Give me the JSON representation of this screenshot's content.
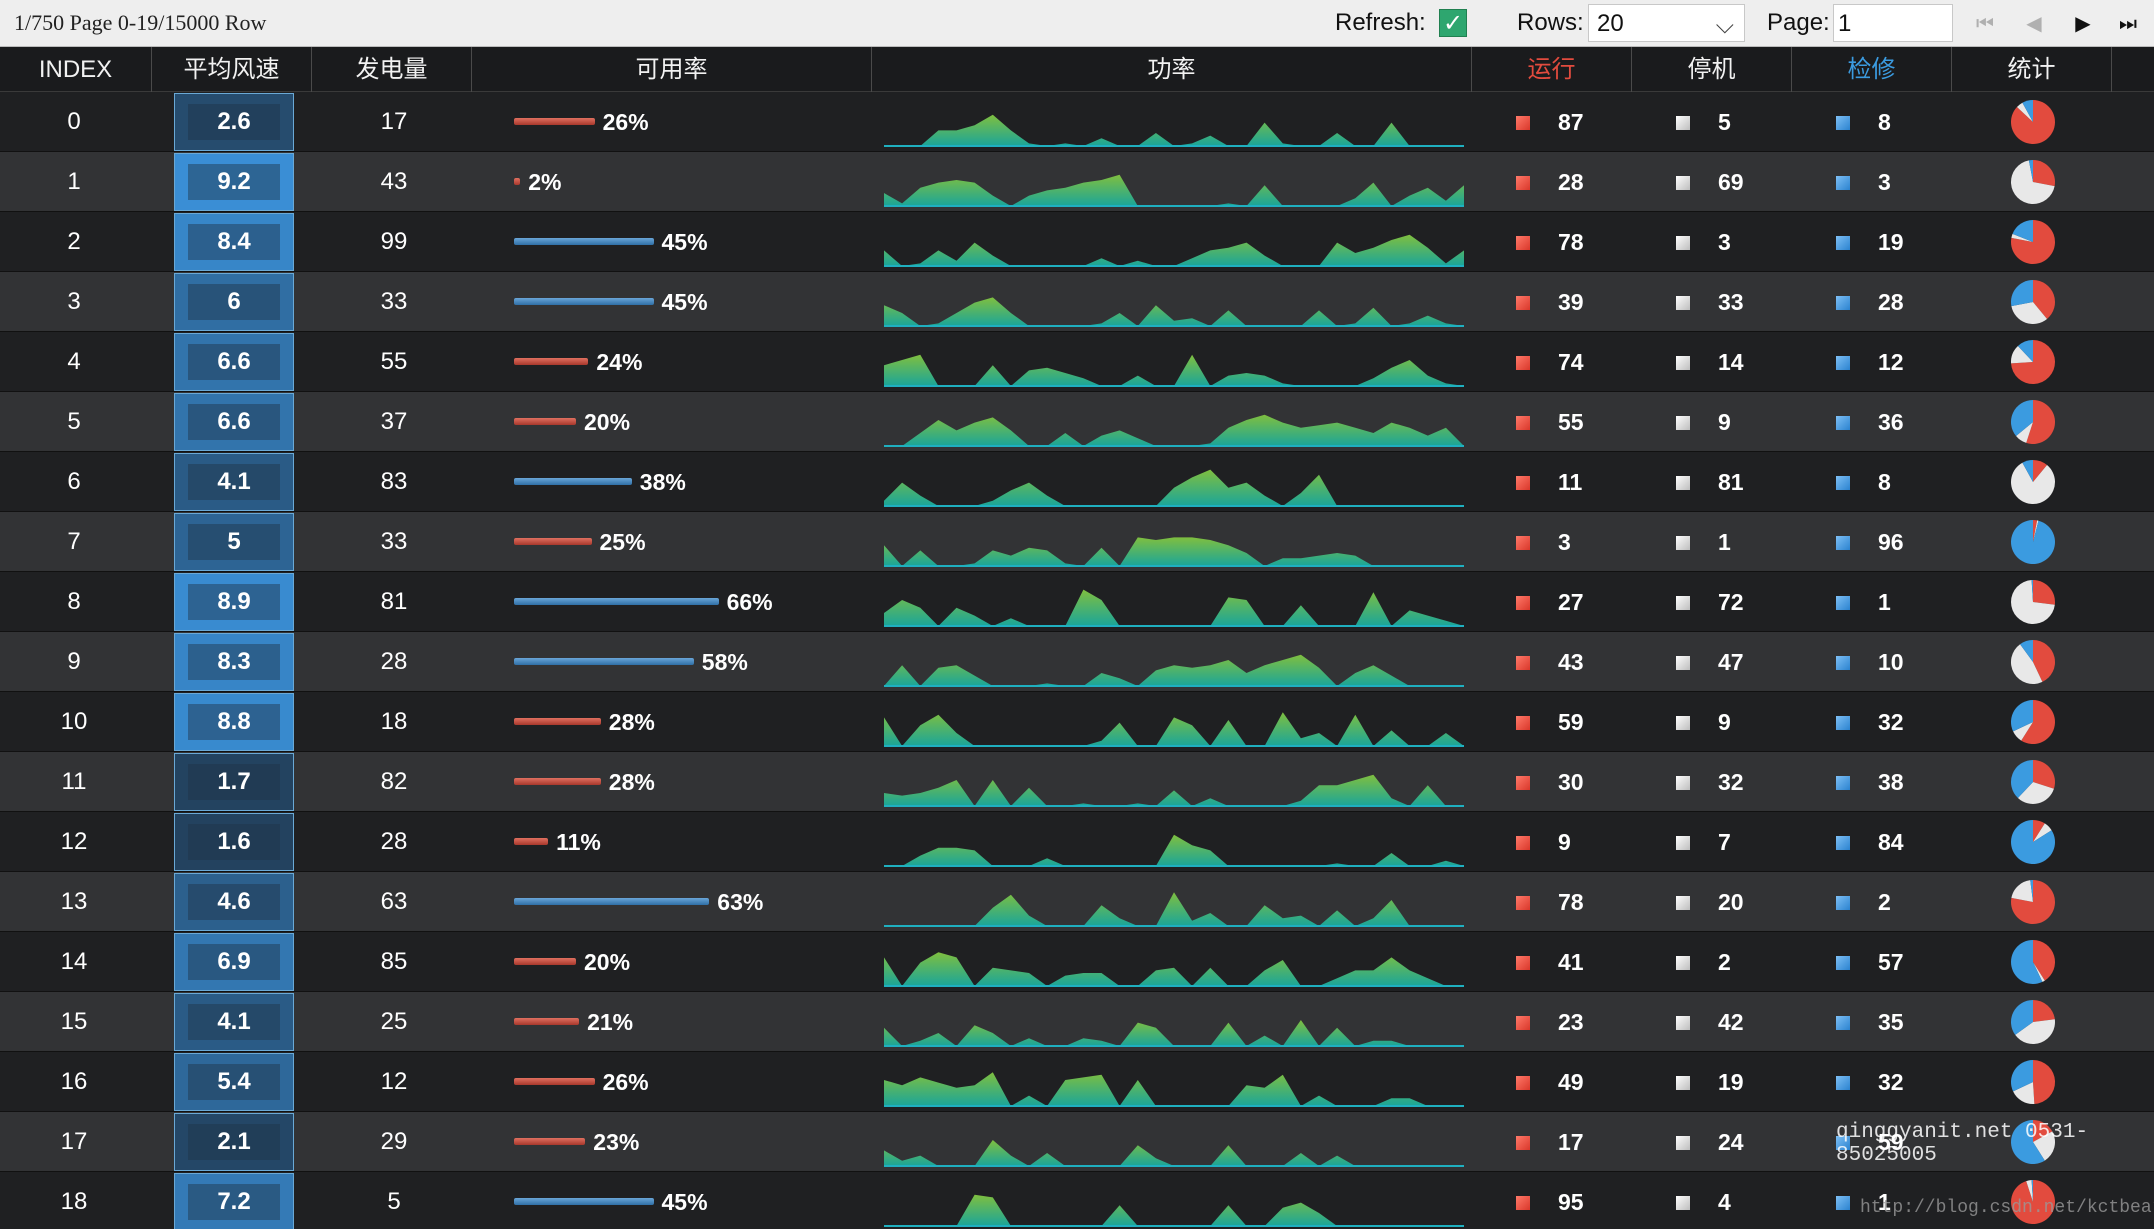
{
  "toolbar": {
    "info": "1/750 Page 0-19/15000 Row",
    "refresh_label": "Refresh:",
    "refresh_checked": true,
    "rows_label": "Rows:",
    "rows_value": "20",
    "page_label": "Page:",
    "page_value": "1"
  },
  "columns": {
    "index": "INDEX",
    "wind": "平均风速",
    "power_gen": "发电量",
    "availability": "可用率",
    "power": "功率",
    "running": "运行",
    "stopped": "停机",
    "maintenance": "检修",
    "stats": "统计"
  },
  "colors": {
    "running": "#e24b3e",
    "stopped": "#e8e8e8",
    "maintenance": "#3b9be0",
    "area_top": "#7fbf3f",
    "area_bottom": "#1aa59a"
  },
  "rows": [
    {
      "index": "0",
      "wind": "2.6",
      "gen": "17",
      "avail": 26,
      "avail_text": "26%",
      "run": "87",
      "stop": "5",
      "maint": "8",
      "spark": [
        0,
        0,
        0,
        6,
        6,
        8,
        12,
        6,
        1,
        0,
        1,
        0,
        3,
        0,
        0,
        5,
        0,
        1,
        4,
        0,
        0,
        9,
        1,
        0,
        0,
        5,
        0,
        0,
        9,
        0,
        0,
        0,
        0
      ]
    },
    {
      "index": "1",
      "wind": "9.2",
      "gen": "43",
      "avail": 2,
      "avail_text": "2%",
      "run": "28",
      "stop": "69",
      "maint": "3",
      "spark": [
        5,
        1,
        7,
        9,
        10,
        9,
        4,
        0,
        4,
        6,
        7,
        9,
        10,
        12,
        0,
        0,
        0,
        0,
        0,
        1,
        0,
        8,
        0,
        0,
        0,
        0,
        3,
        9,
        0,
        4,
        7,
        2,
        8
      ]
    },
    {
      "index": "2",
      "wind": "8.4",
      "gen": "99",
      "avail": 45,
      "avail_text": "45%",
      "run": "78",
      "stop": "3",
      "maint": "19",
      "spark": [
        6,
        0,
        1,
        6,
        2,
        9,
        4,
        0,
        0,
        0,
        0,
        0,
        3,
        0,
        2,
        0,
        0,
        3,
        6,
        7,
        9,
        4,
        0,
        0,
        0,
        9,
        5,
        7,
        10,
        12,
        7,
        1,
        6
      ]
    },
    {
      "index": "3",
      "wind": "6",
      "gen": "33",
      "avail": 45,
      "avail_text": "45%",
      "run": "39",
      "stop": "33",
      "maint": "28",
      "spark": [
        8,
        5,
        0,
        1,
        5,
        9,
        11,
        5,
        0,
        0,
        0,
        0,
        1,
        5,
        0,
        8,
        2,
        3,
        0,
        6,
        0,
        0,
        0,
        0,
        6,
        0,
        1,
        7,
        0,
        1,
        4,
        1,
        0
      ]
    },
    {
      "index": "4",
      "wind": "6.6",
      "gen": "55",
      "avail": 24,
      "avail_text": "24%",
      "run": "74",
      "stop": "14",
      "maint": "12",
      "spark": [
        8,
        10,
        12,
        0,
        0,
        0,
        8,
        0,
        6,
        7,
        5,
        3,
        0,
        0,
        4,
        0,
        0,
        12,
        0,
        4,
        5,
        4,
        1,
        0,
        0,
        0,
        0,
        3,
        7,
        10,
        4,
        1,
        0
      ]
    },
    {
      "index": "5",
      "wind": "6.6",
      "gen": "37",
      "avail": 20,
      "avail_text": "20%",
      "run": "55",
      "stop": "9",
      "maint": "36",
      "spark": [
        0,
        0,
        5,
        10,
        6,
        9,
        11,
        6,
        0,
        0,
        5,
        0,
        4,
        6,
        3,
        0,
        0,
        0,
        1,
        7,
        10,
        12,
        9,
        7,
        8,
        9,
        7,
        5,
        9,
        7,
        4,
        7,
        0
      ]
    },
    {
      "index": "6",
      "wind": "4.1",
      "gen": "83",
      "avail": 38,
      "avail_text": "38%",
      "run": "11",
      "stop": "81",
      "maint": "8",
      "spark": [
        2,
        9,
        4,
        0,
        0,
        0,
        2,
        6,
        9,
        4,
        0,
        0,
        0,
        0,
        0,
        0,
        7,
        11,
        14,
        7,
        9,
        4,
        0,
        5,
        12,
        0,
        0,
        0,
        0,
        0,
        0,
        0,
        0
      ]
    },
    {
      "index": "7",
      "wind": "5",
      "gen": "33",
      "avail": 25,
      "avail_text": "25%",
      "run": "3",
      "stop": "1",
      "maint": "96",
      "spark": [
        8,
        0,
        6,
        0,
        0,
        1,
        6,
        4,
        7,
        6,
        1,
        0,
        7,
        0,
        11,
        10,
        11,
        11,
        10,
        8,
        5,
        0,
        3,
        3,
        4,
        5,
        4,
        0,
        0,
        0,
        0,
        0,
        0
      ]
    },
    {
      "index": "8",
      "wind": "8.9",
      "gen": "81",
      "avail": 66,
      "avail_text": "66%",
      "run": "27",
      "stop": "72",
      "maint": "1",
      "spark": [
        5,
        10,
        7,
        0,
        7,
        4,
        0,
        3,
        0,
        0,
        0,
        14,
        10,
        0,
        0,
        0,
        0,
        0,
        0,
        11,
        10,
        0,
        0,
        8,
        0,
        0,
        0,
        13,
        0,
        6,
        4,
        2,
        0
      ]
    },
    {
      "index": "9",
      "wind": "8.3",
      "gen": "28",
      "avail": 58,
      "avail_text": "58%",
      "run": "43",
      "stop": "47",
      "maint": "10",
      "spark": [
        0,
        8,
        0,
        7,
        8,
        4,
        0,
        0,
        0,
        1,
        0,
        0,
        5,
        3,
        0,
        6,
        8,
        7,
        8,
        10,
        5,
        8,
        10,
        12,
        7,
        0,
        5,
        8,
        4,
        0,
        0,
        0,
        0
      ]
    },
    {
      "index": "10",
      "wind": "8.8",
      "gen": "18",
      "avail": 28,
      "avail_text": "28%",
      "run": "59",
      "stop": "9",
      "maint": "32",
      "spark": [
        11,
        0,
        8,
        12,
        5,
        0,
        0,
        0,
        0,
        0,
        0,
        0,
        2,
        9,
        0,
        0,
        11,
        8,
        0,
        10,
        0,
        0,
        13,
        3,
        5,
        0,
        12,
        0,
        6,
        0,
        0,
        5,
        0
      ]
    },
    {
      "index": "11",
      "wind": "1.7",
      "gen": "82",
      "avail": 28,
      "avail_text": "28%",
      "run": "30",
      "stop": "32",
      "maint": "38",
      "spark": [
        5,
        4,
        5,
        7,
        10,
        0,
        10,
        0,
        7,
        0,
        0,
        1,
        0,
        0,
        1,
        0,
        6,
        0,
        3,
        0,
        0,
        0,
        0,
        2,
        8,
        8,
        10,
        12,
        3,
        0,
        8,
        0,
        0
      ]
    },
    {
      "index": "12",
      "wind": "1.6",
      "gen": "28",
      "avail": 11,
      "avail_text": "11%",
      "run": "9",
      "stop": "7",
      "maint": "84",
      "spark": [
        0,
        0,
        4,
        7,
        7,
        6,
        0,
        0,
        0,
        3,
        0,
        0,
        0,
        0,
        0,
        0,
        12,
        8,
        6,
        0,
        0,
        0,
        0,
        0,
        0,
        1,
        0,
        0,
        5,
        0,
        0,
        2,
        0
      ]
    },
    {
      "index": "13",
      "wind": "4.6",
      "gen": "63",
      "avail": 63,
      "avail_text": "63%",
      "run": "78",
      "stop": "20",
      "maint": "2",
      "spark": [
        0,
        0,
        0,
        0,
        0,
        0,
        7,
        12,
        4,
        0,
        0,
        0,
        8,
        3,
        0,
        0,
        13,
        2,
        5,
        0,
        0,
        8,
        3,
        4,
        0,
        6,
        0,
        3,
        10,
        0,
        0,
        0,
        0
      ]
    },
    {
      "index": "14",
      "wind": "6.9",
      "gen": "85",
      "avail": 20,
      "avail_text": "20%",
      "run": "41",
      "stop": "2",
      "maint": "57",
      "spark": [
        11,
        0,
        9,
        13,
        11,
        0,
        7,
        6,
        5,
        0,
        4,
        5,
        5,
        0,
        0,
        6,
        7,
        0,
        7,
        0,
        0,
        6,
        10,
        0,
        0,
        3,
        6,
        6,
        11,
        6,
        3,
        0,
        0
      ]
    },
    {
      "index": "15",
      "wind": "4.1",
      "gen": "25",
      "avail": 21,
      "avail_text": "21%",
      "run": "23",
      "stop": "42",
      "maint": "35",
      "spark": [
        7,
        0,
        2,
        5,
        0,
        8,
        5,
        0,
        3,
        0,
        0,
        3,
        2,
        0,
        9,
        7,
        0,
        0,
        0,
        9,
        0,
        4,
        0,
        10,
        0,
        7,
        0,
        2,
        2,
        0,
        0,
        0,
        0
      ]
    },
    {
      "index": "16",
      "wind": "5.4",
      "gen": "12",
      "avail": 26,
      "avail_text": "26%",
      "run": "49",
      "stop": "19",
      "maint": "32",
      "spark": [
        10,
        8,
        11,
        9,
        7,
        8,
        13,
        0,
        4,
        0,
        10,
        11,
        12,
        0,
        10,
        0,
        0,
        0,
        0,
        0,
        8,
        7,
        12,
        0,
        4,
        0,
        0,
        0,
        3,
        3,
        0,
        0,
        0
      ]
    },
    {
      "index": "17",
      "wind": "2.1",
      "gen": "29",
      "avail": 23,
      "avail_text": "23%",
      "run": "17",
      "stop": "24",
      "maint": "59",
      "spark": [
        6,
        2,
        4,
        0,
        0,
        0,
        10,
        4,
        0,
        5,
        0,
        0,
        0,
        0,
        8,
        3,
        0,
        0,
        0,
        8,
        0,
        0,
        0,
        5,
        0,
        4,
        0,
        0,
        0,
        0,
        0,
        0,
        0
      ]
    },
    {
      "index": "18",
      "wind": "7.2",
      "gen": "5",
      "avail": 45,
      "avail_text": "45%",
      "run": "95",
      "stop": "4",
      "maint": "1",
      "spark": [
        0,
        0,
        0,
        0,
        0,
        12,
        11,
        0,
        0,
        0,
        0,
        0,
        0,
        8,
        0,
        0,
        0,
        0,
        0,
        8,
        0,
        0,
        7,
        9,
        5,
        0,
        0,
        0,
        0,
        0,
        0,
        0,
        0
      ]
    }
  ],
  "watermark": {
    "line1": "qinggyanit.net 0531-85025005",
    "line2": "http://blog.csdn.net/kctbear"
  }
}
